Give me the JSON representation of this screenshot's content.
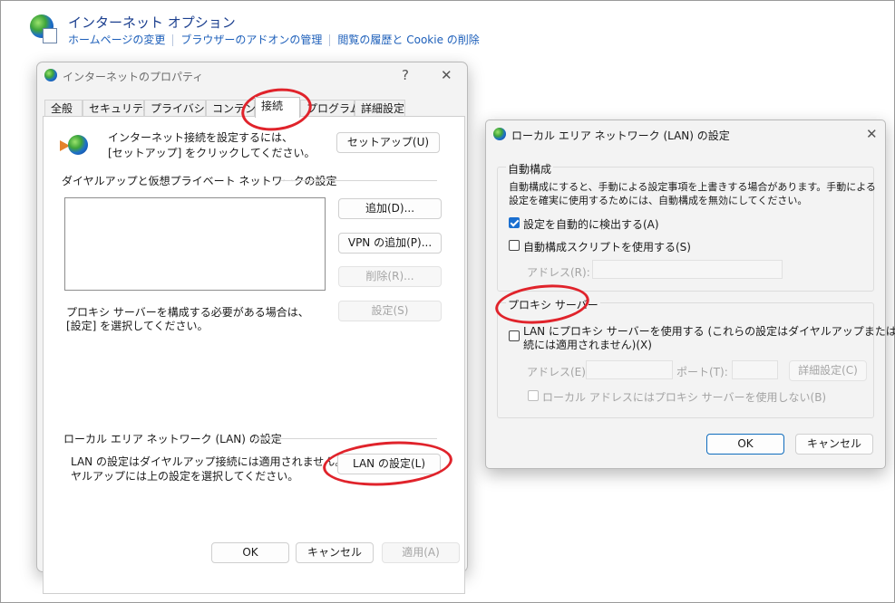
{
  "header": {
    "title": "インターネット オプション",
    "links": [
      "ホームページの変更",
      "ブラウザーのアドオンの管理",
      "閲覧の履歴と Cookie の削除"
    ]
  },
  "dialog1": {
    "title": "インターネットのプロパティ",
    "help": "?",
    "close": "✕",
    "tabs": [
      "全般",
      "セキュリティ",
      "プライバシー",
      "コンテンツ",
      "接続",
      "プログラム",
      "詳細設定"
    ],
    "setup_text_1": "インターネット接続を設定するには、",
    "setup_text_2": "[セットアップ] をクリックしてください。",
    "setup_button": "セットアップ(U)",
    "dialup_group": "ダイヤルアップと仮想プライベート ネットワークの設定",
    "add_button": "追加(D)...",
    "vpn_button": "VPN の追加(P)...",
    "remove_button": "削除(R)...",
    "settings_button": "設定(S)",
    "proxy_text_1": "プロキシ サーバーを構成する必要がある場合は、",
    "proxy_text_2": "[設定] を選択してください。",
    "lan_group": "ローカル エリア ネットワーク (LAN) の設定",
    "lan_text_1": "LAN の設定はダイヤルアップ接続には適用されません。ダイ",
    "lan_text_2": "ヤルアップには上の設定を選択してください。",
    "lan_button": "LAN の設定(L)",
    "ok": "OK",
    "cancel": "キャンセル",
    "apply": "適用(A)"
  },
  "dialog2": {
    "title": "ローカル エリア ネットワーク (LAN) の設定",
    "close": "✕",
    "auto_group": "自動構成",
    "auto_desc_1": "自動構成にすると、手動による設定事項を上書きする場合があります。手動による",
    "auto_desc_2": "設定を確実に使用するためには、自動構成を無効にしてください。",
    "auto_detect": "設定を自動的に検出する(A)",
    "auto_detect_checked": true,
    "auto_script": "自動構成スクリプトを使用する(S)",
    "auto_script_checked": false,
    "address_label": "アドレス(R):",
    "proxy_group": "プロキシ サーバー",
    "use_proxy_1": "LAN にプロキシ サーバーを使用する (これらの設定はダイヤルアップまたは VPN 接",
    "use_proxy_2": "続には適用されません)(X)",
    "use_proxy_checked": false,
    "proxy_address_label": "アドレス(E):",
    "port_label": "ポート(T):",
    "advanced_button": "詳細設定(C)",
    "bypass_local": "ローカル アドレスにはプロキシ サーバーを使用しない(B)",
    "bypass_checked": false,
    "ok": "OK",
    "cancel": "キャンセル"
  },
  "colors": {
    "link": "#1d5fba",
    "annotation": "#e0232b",
    "accent": "#1a6fd0"
  }
}
